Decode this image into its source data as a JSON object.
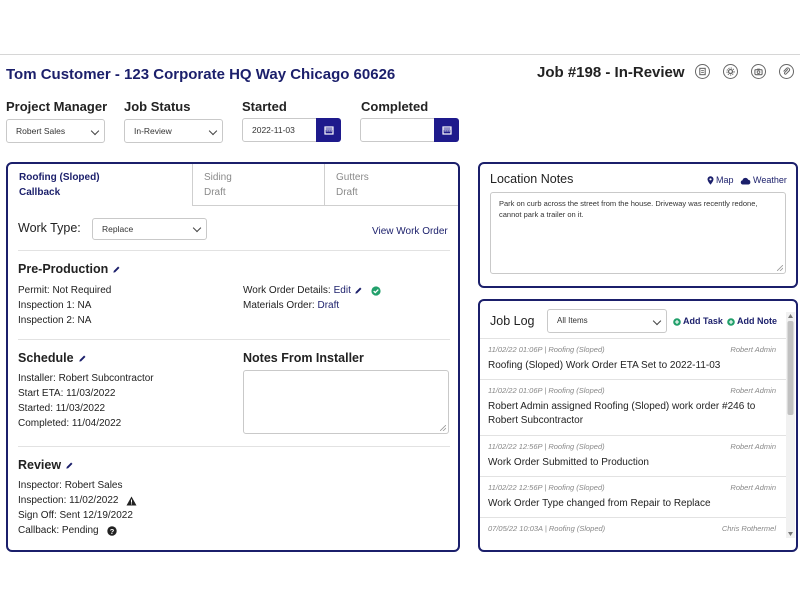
{
  "header": {
    "customer_title": "Tom Customer - 123 Corporate HQ Way Chicago 60626",
    "job_title": "Job #198 - In-Review",
    "icons": [
      "receipt-icon",
      "gear-icon",
      "camera-icon",
      "paperclip-icon"
    ]
  },
  "fields": {
    "project_manager": {
      "label": "Project Manager",
      "value": "Robert Sales"
    },
    "job_status": {
      "label": "Job Status",
      "value": "In-Review"
    },
    "started": {
      "label": "Started",
      "value": "2022-11-03"
    },
    "completed": {
      "label": "Completed",
      "value": ""
    }
  },
  "tabs": [
    {
      "line1": "Roofing (Sloped)",
      "line2": "Callback"
    },
    {
      "line1": "Siding",
      "line2": "Draft"
    },
    {
      "line1": "Gutters",
      "line2": "Draft"
    }
  ],
  "work": {
    "type_label": "Work Type:",
    "type_value": "Replace",
    "view_link": "View Work Order"
  },
  "preproduction": {
    "title": "Pre-Production",
    "permit": "Permit: Not Required",
    "inspection1": "Inspection 1: NA",
    "inspection2": "Inspection 2: NA",
    "wo_details_label": "Work Order Details:",
    "wo_details_link": "Edit",
    "materials_label": "Materials Order:",
    "materials_link": "Draft"
  },
  "schedule": {
    "title": "Schedule",
    "installer": "Installer: Robert Subcontractor",
    "start_eta": "Start ETA: 11/03/2022",
    "started": "Started: 11/03/2022",
    "completed": "Completed: 11/04/2022"
  },
  "installer_notes": {
    "title": "Notes From Installer",
    "value": ""
  },
  "review": {
    "title": "Review",
    "inspector": "Inspector: Robert Sales",
    "inspection": "Inspection: 11/02/2022",
    "signoff": "Sign Off: Sent 12/19/2022",
    "callback": "Callback: Pending"
  },
  "location_notes": {
    "title": "Location Notes",
    "map_label": "Map",
    "weather_label": "Weather",
    "text": "Park on curb across the street from the house. Driveway was recently redone, cannot park a trailer on it."
  },
  "job_log": {
    "title": "Job Log",
    "filter_value": "All Items",
    "add_task": "Add Task",
    "add_note": "Add Note",
    "entries": [
      {
        "meta": "11/02/22 01:06P | Roofing (Sloped)",
        "author": "Robert Admin",
        "msg": "Roofing (Sloped) Work Order ETA Set to 2022-11-03"
      },
      {
        "meta": "11/02/22 01:06P | Roofing (Sloped)",
        "author": "Robert Admin",
        "msg": "Robert Admin assigned Roofing (Sloped) work order #246 to Robert Subcontractor"
      },
      {
        "meta": "11/02/22 12:56P | Roofing (Sloped)",
        "author": "Robert Admin",
        "msg": "Work Order Submitted to Production"
      },
      {
        "meta": "11/02/22 12:56P | Roofing (Sloped)",
        "author": "Robert Admin",
        "msg": "Work Order Type changed from Repair to Replace"
      },
      {
        "meta": "07/05/22 10:03A | Roofing (Sloped)",
        "author": "Chris Rothermel",
        "msg": ""
      }
    ]
  },
  "colors": {
    "brand": "#1b1f6b",
    "button": "#1e1a8c",
    "success": "#22a06b",
    "add": "#22a06b"
  }
}
